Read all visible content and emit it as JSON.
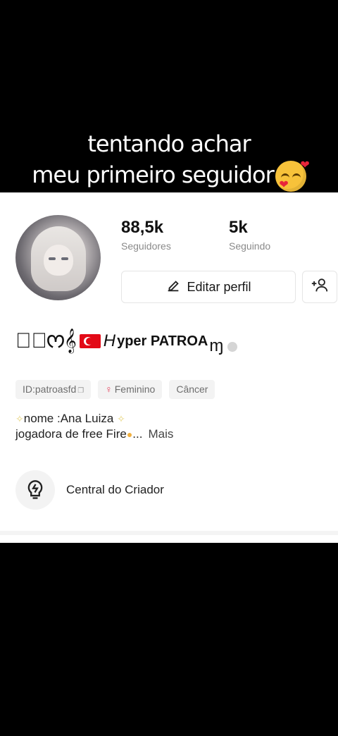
{
  "overlay": {
    "line1": "tentando achar",
    "line2": "meu primeiro seguidor",
    "emoji": "smiling-face-with-hearts"
  },
  "profile": {
    "stats": [
      {
        "value": "88,5k",
        "label": "Seguidores"
      },
      {
        "value": "5k",
        "label": "Seguindo"
      }
    ],
    "edit_label": "Editar perfil",
    "name_prefix": "ꚰ⃟ᰔ𝄞",
    "name_h": "H",
    "name_main": "yper PATROA",
    "name_suffix": "ɱ",
    "tags": {
      "id": "ID:patroasfd",
      "gender": "Feminino",
      "zodiac": "Câncer"
    },
    "bio_line1": "nome :Ana Luiza",
    "bio_line2": "jogadora de free Fire",
    "bio_ellipsis": "...",
    "more_label": "Mais",
    "creator_label": "Central do Criador"
  },
  "colors": {
    "accent": "#e33a56",
    "flag_red": "#e30a17",
    "overlay_background": "#000000"
  },
  "icons": [
    "pencil-icon",
    "add-friend-icon",
    "copy-icon",
    "female-icon",
    "lightbulb-icon",
    "verified-badge-icon",
    "turkey-flag-icon"
  ]
}
